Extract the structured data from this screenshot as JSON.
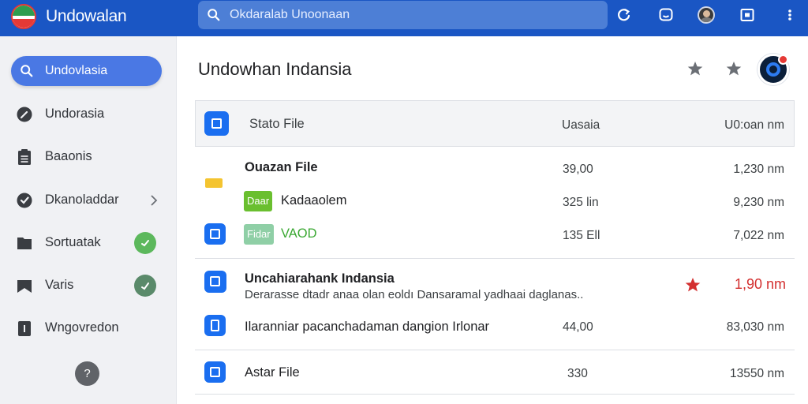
{
  "app": {
    "title": "Undowalan"
  },
  "search": {
    "placeholder": "Okdaralab Unoonaan"
  },
  "colors": {
    "topbar": "#1a56c4",
    "accent": "#4a78e4",
    "icon_blue": "#1a6ef0",
    "highlight_red": "#d32f2f",
    "tag_green": "#6abf2f"
  },
  "toolbar_icons": [
    "refresh-icon",
    "chat-icon",
    "user-avatar",
    "window-icon",
    "more-vert-icon"
  ],
  "sidebar": {
    "search_label": "Undovlasia",
    "items": [
      {
        "label": "Undorasia",
        "icon": "compass-icon"
      },
      {
        "label": "Baaonis",
        "icon": "clipboard-icon"
      },
      {
        "label": "Dkanoladdar",
        "icon": "check-circle-icon"
      },
      {
        "label": "Sortuatak",
        "icon": "folder-icon"
      },
      {
        "label": "Varis",
        "icon": "flag-icon"
      },
      {
        "label": "Wngovredon",
        "icon": "document-icon"
      }
    ],
    "help_label": "?"
  },
  "main": {
    "title": "Undowhan Indansia",
    "header": {
      "name": "Stato File",
      "col2": "Uasaia",
      "col3": "U0:oan nm"
    },
    "rows": [
      {
        "name": "Ouazan File",
        "col2": "39,00",
        "size": "1,230 nm"
      },
      {
        "tag": "Daar",
        "name": "Kadaaolem",
        "col2": "325 lin",
        "size": "9,230 nm"
      },
      {
        "tag": "Fidar",
        "name": "VAOD",
        "col2": "135 Ell",
        "size": "7,022 nm"
      },
      {
        "name": "Uncahiarahank Indansia",
        "subtitle": "Derarasse dtadr anaa olan eoldı Dansaramal yadhaai daglanas..",
        "size": "1,90 nm"
      },
      {
        "name": "Ilaranniar pacanchadaman dangion Irlonar",
        "col2": "44,00",
        "size": "83,030 nm"
      },
      {
        "name": "Astar File",
        "col2": "330",
        "size": "13550 nm"
      }
    ]
  }
}
